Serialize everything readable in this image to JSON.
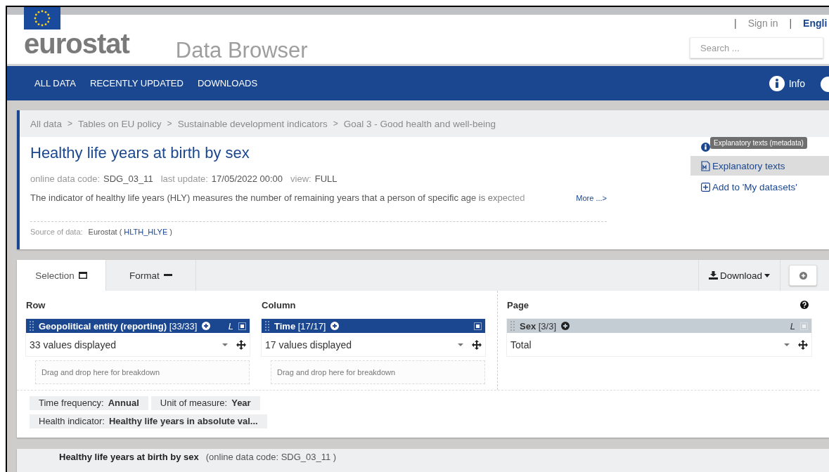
{
  "header": {
    "separator": "|",
    "logo": "eurostat",
    "app_title": "Data Browser",
    "links": [
      {
        "label": "Sign in",
        "selected": false
      },
      {
        "label": "Engli",
        "selected": true
      }
    ],
    "search": {
      "placeholder": "Search ..."
    }
  },
  "nav": {
    "items": [
      "ALL DATA",
      "RECENTLY UPDATED",
      "DOWNLOADS"
    ],
    "info": "Info"
  },
  "dataset": {
    "breadcrumb_separator": ">",
    "breadcrumb": [
      "All data",
      "Tables on EU policy",
      "Sustainable development indicators",
      "Goal 3 - Good health and well-being"
    ],
    "title": "Healthy life years at birth by sex",
    "meta": [
      {
        "label": "online data code:",
        "value": "SDG_03_11"
      },
      {
        "label": "last update:",
        "value": "17/05/2022 00:00"
      },
      {
        "label": "view:",
        "value": "FULL"
      }
    ],
    "description": "The indicator of healthy life years (HLY) measures the number of remaining years that a person of specific age is expected",
    "more": "More ...>",
    "source_label": "Source of data:",
    "source": "Eurostat (",
    "source_code": "HLTH_HLYE",
    "source_end": ")",
    "tooltip": "Explanatory texts (metadata)",
    "actions": [
      {
        "kind": "metadata",
        "label": "Explanatory texts",
        "selected": true
      },
      {
        "kind": "add",
        "label": "Add to 'My datasets'",
        "selected": false
      }
    ]
  },
  "selection": {
    "tabs": [
      {
        "label": "Selection",
        "kind": "window",
        "selected": true
      },
      {
        "label": "Format",
        "kind": "minus",
        "selected": false
      }
    ],
    "download": "Download",
    "zones": [
      {
        "heading": "Row",
        "dimension": "Geopolitical entity (reporting)",
        "count": "[33/33]",
        "active": true,
        "toggle": "L",
        "value": "33 values displayed",
        "dropzone": "Drag and drop here for breakdown"
      },
      {
        "heading": "Column",
        "dimension": "Time",
        "count": "[17/17]",
        "active": true,
        "value": "17 values displayed",
        "dropzone": "Drag and drop here for breakdown"
      },
      {
        "heading": "Page",
        "dimension": "Sex",
        "count": "[3/3]",
        "active": false,
        "toggle": "L",
        "value": "Total"
      }
    ],
    "filters": [
      {
        "label": "Time frequency:",
        "value": "Annual"
      },
      {
        "label": "Unit of measure:",
        "value": "Year"
      },
      {
        "label": "Health indicator:",
        "value": "Healthy life years in absolute val..."
      }
    ]
  },
  "next_table": {
    "title": "Healthy life years at birth by sex",
    "code": "(online data code: SDG_03_11 )"
  }
}
